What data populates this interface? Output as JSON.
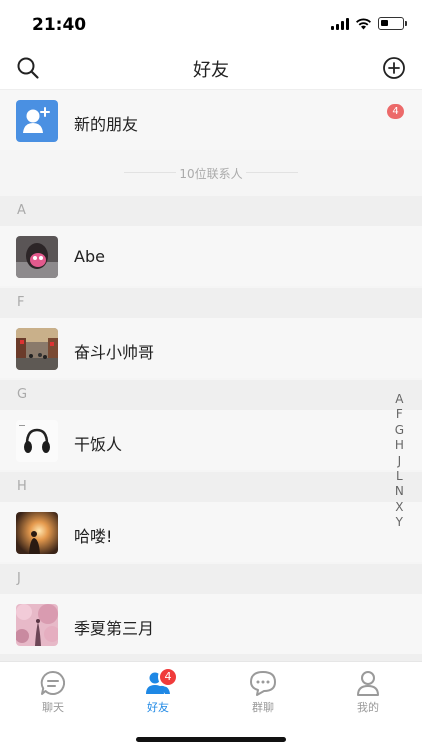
{
  "status_bar": {
    "time": "21:40",
    "battery_level": 0.35
  },
  "nav": {
    "title": "好友",
    "left_icon": "search-icon",
    "right_icon": "plus-circle-icon"
  },
  "new_friend": {
    "label": "新的朋友",
    "badge": "4",
    "icon": "add-person-icon",
    "color": "#4a90e2"
  },
  "contact_count": "10位联系人",
  "sections": [
    {
      "letter": "A",
      "contacts": [
        {
          "name": "Abe",
          "avatar": "pink-photo-avatar"
        }
      ]
    },
    {
      "letter": "F",
      "contacts": [
        {
          "name": "奋斗小帅哥",
          "avatar": "street-photo-avatar"
        }
      ]
    },
    {
      "letter": "G",
      "contacts": [
        {
          "name": "干饭人",
          "avatar": "headphones-photo-avatar"
        }
      ]
    },
    {
      "letter": "H",
      "contacts": [
        {
          "name": "哈喽!",
          "avatar": "sunset-photo-avatar"
        }
      ]
    },
    {
      "letter": "J",
      "contacts": [
        {
          "name": "季夏第三月",
          "avatar": "cherry-blossom-photo-avatar"
        }
      ]
    }
  ],
  "index_letters": [
    "A",
    "F",
    "G",
    "H",
    "J",
    "L",
    "N",
    "X",
    "Y"
  ],
  "tabs": [
    {
      "label": "聊天",
      "icon": "chat-bubble-icon",
      "active": false
    },
    {
      "label": "好友",
      "icon": "friends-icon",
      "active": true,
      "badge": "4"
    },
    {
      "label": "群聊",
      "icon": "group-chat-icon",
      "active": false
    },
    {
      "label": "我的",
      "icon": "profile-icon",
      "active": false
    }
  ],
  "colors": {
    "accent": "#1e88e5",
    "badge_red": "#f03b3b",
    "new_friend_badge": "#ec6a6a"
  }
}
